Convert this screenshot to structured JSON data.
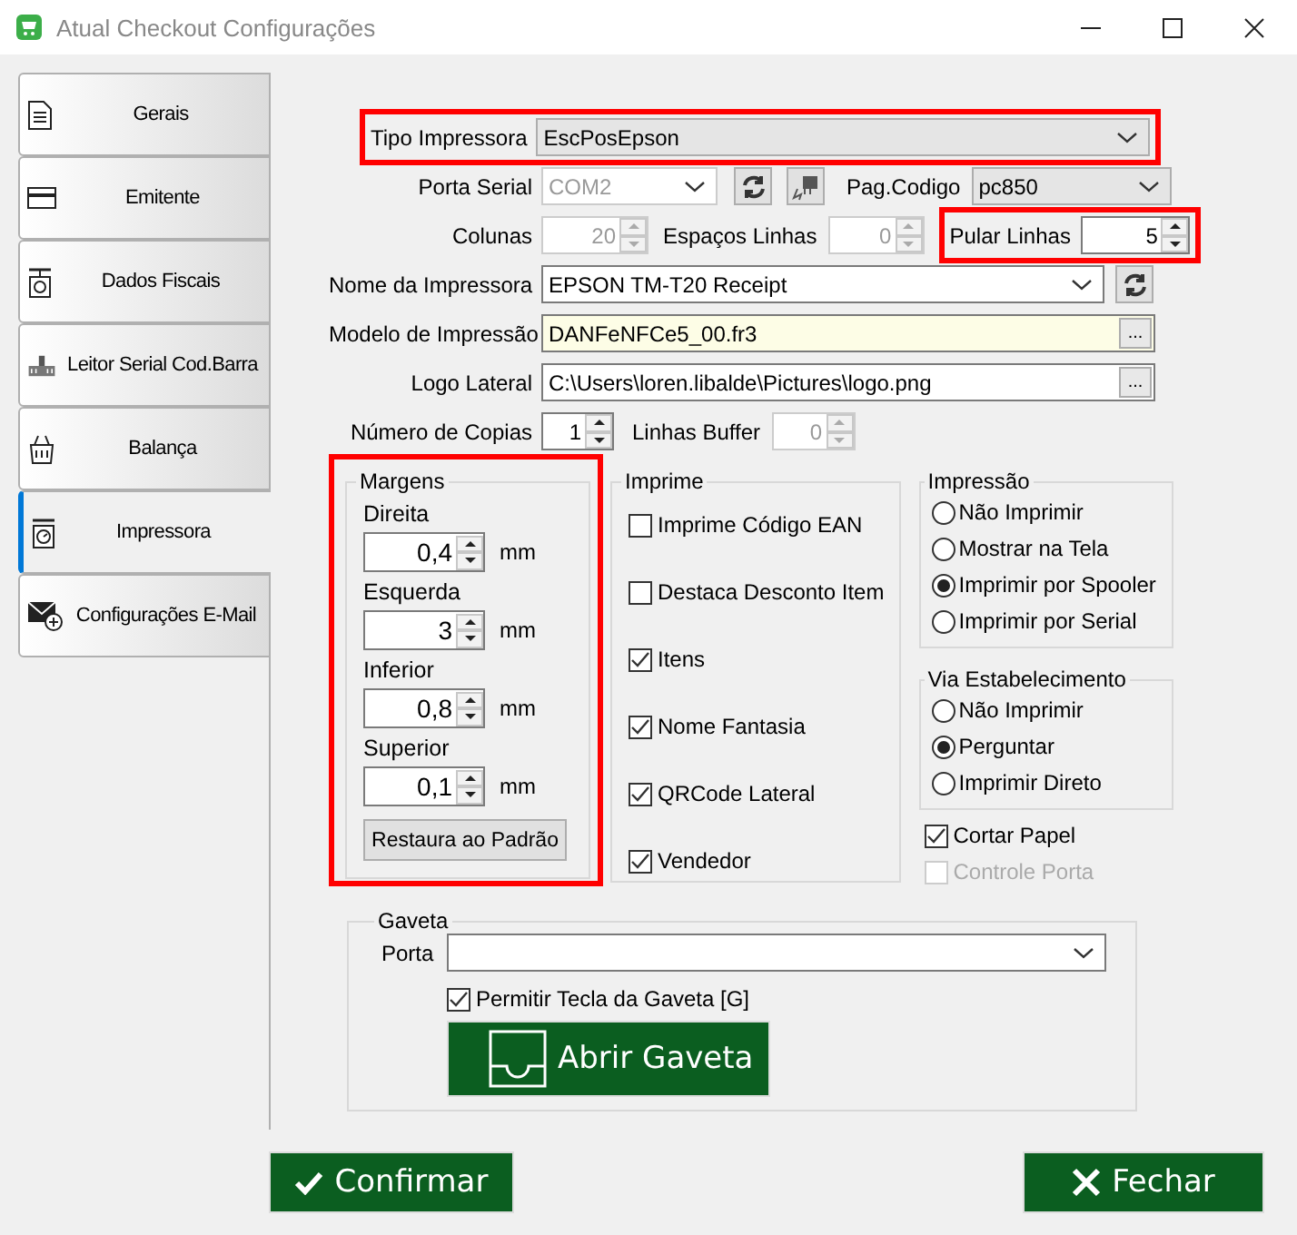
{
  "window": {
    "title": "Atual Checkout Configurações"
  },
  "sidebar": {
    "items": [
      {
        "label": "Gerais",
        "selected": false
      },
      {
        "label": "Emitente",
        "selected": false
      },
      {
        "label": "Dados Fiscais",
        "selected": false
      },
      {
        "label": "Leitor Serial Cod.Barra",
        "selected": false
      },
      {
        "label": "Balança",
        "selected": false
      },
      {
        "label": "Impressora",
        "selected": true
      },
      {
        "label": "Configurações E-Mail",
        "selected": false
      }
    ]
  },
  "printer": {
    "tipo_impressora": {
      "label": "Tipo Impressora",
      "value": "EscPosEpson",
      "highlighted": true
    },
    "porta_serial": {
      "label": "Porta Serial",
      "value": "COM2",
      "disabled": true
    },
    "pag_codigo": {
      "label": "Pag.Codigo",
      "value": "pc850"
    },
    "colunas": {
      "label": "Colunas",
      "value": "20",
      "disabled": true
    },
    "espacos_linhas": {
      "label": "Espaços Linhas",
      "value": "0",
      "disabled": true
    },
    "pular_linhas": {
      "label": "Pular Linhas",
      "value": "5",
      "highlighted": true
    },
    "nome_impressora": {
      "label": "Nome da Impressora",
      "value": "EPSON TM-T20 Receipt"
    },
    "modelo_impressao": {
      "label": "Modelo de Impressão",
      "value": "DANFeNFCe5_00.fr3",
      "browse": "..."
    },
    "logo_lateral": {
      "label": "Logo Lateral",
      "value": "C:\\Users\\loren.libalde\\Pictures\\logo.png",
      "browse": "..."
    },
    "numero_copias": {
      "label": "Número de Copias",
      "value": "1",
      "disabled": false
    },
    "linhas_buffer": {
      "label": "Linhas Buffer",
      "value": "0",
      "disabled": true
    }
  },
  "margens": {
    "title": "Margens",
    "highlighted": true,
    "fields": [
      {
        "label": "Direita",
        "value": "0,4",
        "unit": "mm"
      },
      {
        "label": "Esquerda",
        "value": "3",
        "unit": "mm"
      },
      {
        "label": "Inferior",
        "value": "0,8",
        "unit": "mm"
      },
      {
        "label": "Superior",
        "value": "0,1",
        "unit": "mm"
      }
    ],
    "reset_button": "Restaura ao Padrão"
  },
  "imprime": {
    "title": "Imprime",
    "options": [
      {
        "label": "Imprime Código EAN",
        "checked": false
      },
      {
        "label": "Destaca Desconto Item",
        "checked": false
      },
      {
        "label": "Itens",
        "checked": true
      },
      {
        "label": "Nome Fantasia",
        "checked": true
      },
      {
        "label": "QRCode Lateral",
        "checked": true
      },
      {
        "label": "Vendedor",
        "checked": true
      }
    ]
  },
  "impressao": {
    "title": "Impressão",
    "options": [
      {
        "label": "Não Imprimir",
        "selected": false
      },
      {
        "label": "Mostrar na Tela",
        "selected": false
      },
      {
        "label": "Imprimir por Spooler",
        "selected": true
      },
      {
        "label": "Imprimir por Serial",
        "selected": false
      }
    ]
  },
  "via_estabelecimento": {
    "title": "Via Estabelecimento",
    "options": [
      {
        "label": "Não Imprimir",
        "selected": false
      },
      {
        "label": "Perguntar",
        "selected": true
      },
      {
        "label": "Imprimir Direto",
        "selected": false
      }
    ]
  },
  "extra_options": [
    {
      "label": "Cortar Papel",
      "checked": true,
      "disabled": false
    },
    {
      "label": "Controle Porta",
      "checked": false,
      "disabled": true
    }
  ],
  "gaveta": {
    "title": "Gaveta",
    "porta_label": "Porta",
    "permitir": {
      "label": "Permitir Tecla da Gaveta [G]",
      "checked": true
    },
    "open_button": "Abrir Gaveta"
  },
  "footer": {
    "confirm": "Confirmar",
    "close": "Fechar"
  }
}
